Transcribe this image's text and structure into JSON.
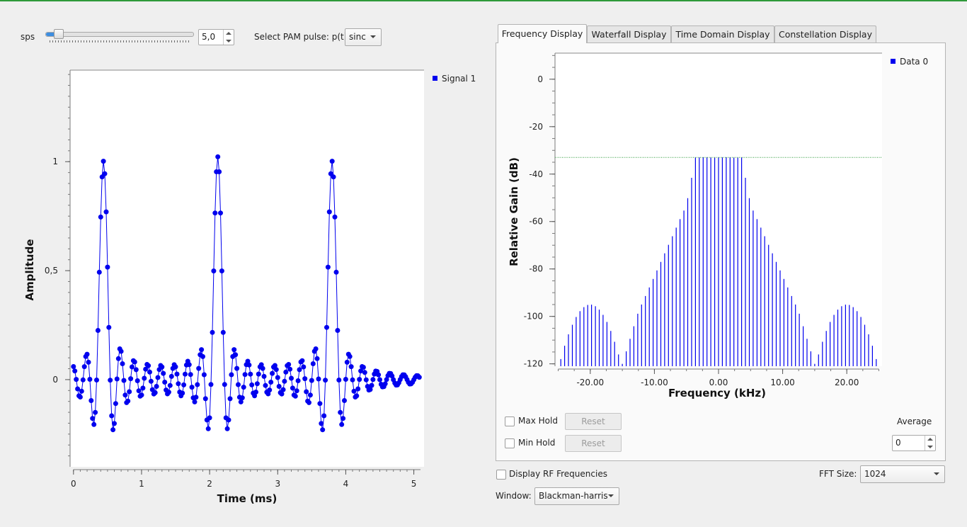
{
  "controls": {
    "sps_label": "sps",
    "sps_value": "5,0",
    "sps_slider_fraction": 0.07,
    "pam_label": "Select PAM pulse: p(t):",
    "pam_value": "sinc"
  },
  "tabs": [
    {
      "label": "Frequency Display",
      "active": true
    },
    {
      "label": "Waterfall Display",
      "active": false
    },
    {
      "label": "Time Domain Display",
      "active": false
    },
    {
      "label": "Constellation Display",
      "active": false
    }
  ],
  "fft_options": {
    "max_hold_label": "Max Hold",
    "min_hold_label": "Min Hold",
    "reset_label": "Reset",
    "average_label": "Average",
    "average_value": "0",
    "display_rf_label": "Display RF Frequencies",
    "fft_size_label": "FFT Size:",
    "fft_size_value": "1024",
    "window_label": "Window:",
    "window_value": "Blackman-harris"
  },
  "colors": {
    "series": "#0000ee",
    "trigger": "#2e9a3a",
    "accent": "#3d8de0"
  },
  "chart_data": [
    {
      "type": "line",
      "title": "",
      "xlabel": "Time (ms)",
      "ylabel": "Amplitude",
      "legend": "Signal 1",
      "legend_position": "top-right",
      "xlim": [
        -0.05,
        5.15
      ],
      "ylim": [
        -0.4,
        1.42
      ],
      "xticks": [
        0,
        1,
        2,
        3,
        4,
        5
      ],
      "xtick_labels": [
        "0",
        "1",
        "2",
        "3",
        "4",
        "5"
      ],
      "yticks": [
        0,
        0.5,
        1
      ],
      "ytick_labels": [
        "0",
        "0,5",
        "1"
      ],
      "pulse_centers_ms": [
        0.44,
        2.12,
        3.8
      ],
      "sample_spacing_ms": 0.02,
      "markers": true
    },
    {
      "type": "line",
      "title": "",
      "xlabel": "Frequency (kHz)",
      "ylabel": "Relative Gain (dB)",
      "legend": "Data 0",
      "legend_position": "top-right",
      "xlim": [
        -25.5,
        25.5
      ],
      "ylim": [
        -121,
        11
      ],
      "xticks": [
        -20,
        -10,
        0,
        10,
        20
      ],
      "xtick_labels": [
        "-20.00",
        "-10.00",
        "0.00",
        "10.00",
        "20.00"
      ],
      "yticks": [
        0,
        -20,
        -40,
        -60,
        -80,
        -100,
        -120
      ],
      "ytick_labels": [
        "0",
        "-20",
        "-40",
        "-60",
        "-80",
        "-100",
        "-120"
      ],
      "reference_level_db": -33,
      "line_spacing_khz": 0.6,
      "noise_floor_db": -121
    }
  ]
}
